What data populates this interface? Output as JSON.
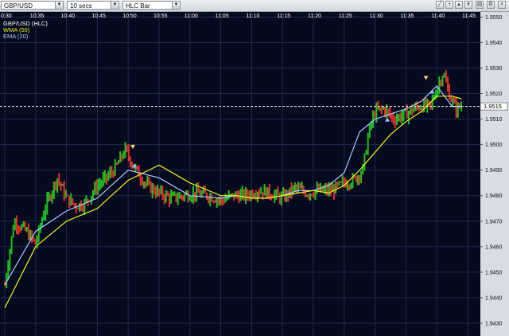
{
  "toolbar": {
    "symbol": "GBP/USD",
    "interval": "10 secs",
    "chart_style": "HLC Bar",
    "tools": [
      "draw-line-icon",
      "crosshair-icon",
      "zoom-in-icon",
      "zoom-out-icon",
      "print-icon",
      "settings-icon",
      "close-icon"
    ]
  },
  "legend": {
    "price": "GBP/USD (HLC)",
    "wma": "WMA (55)",
    "ema": "EMA (20)"
  },
  "colors": {
    "background": "#050a1e",
    "grid": "#1c2a4e",
    "up_bar": "#20c020",
    "down_bar": "#e03030",
    "wma": "#f0f020",
    "ema": "#b0c8ff",
    "marker_sell": "#ffd080",
    "marker_buy": "#9ec6ff"
  },
  "chart_data": {
    "type": "line",
    "x_ticks": [
      "0:30",
      "10:35",
      "10:40",
      "10:45",
      "10:50",
      "10:55",
      "11:00",
      "11:05",
      "11:10",
      "11:15",
      "11:20",
      "11:25",
      "11:30",
      "11:35",
      "11:40",
      "11:45"
    ],
    "y_ticks": [
      1.943,
      1.944,
      1.945,
      1.946,
      1.947,
      1.948,
      1.949,
      1.95,
      1.951,
      1.952,
      1.953,
      1.954,
      1.955
    ],
    "ylim": [
      1.9425,
      1.9552
    ],
    "current_price": 1.9515,
    "current_price_label": "1.9515",
    "grid": true,
    "series": [
      {
        "name": "WMA (55)",
        "color": "#f0f020",
        "x": [
          0.0,
          1.0,
          2.0,
          3.0,
          4.0,
          5.0,
          6.0,
          7.0,
          7.5,
          8.0,
          8.5,
          9.0,
          9.5,
          10.0,
          10.5,
          11.0,
          11.5,
          12.0,
          12.5,
          13.0,
          13.5,
          14.0,
          14.5,
          14.8
        ],
        "values": [
          1.9436,
          1.946,
          1.947,
          1.9475,
          1.9486,
          1.9492,
          1.9485,
          1.948,
          1.948,
          1.9479,
          1.9479,
          1.948,
          1.9481,
          1.9482,
          1.9481,
          1.9484,
          1.949,
          1.9497,
          1.9504,
          1.9509,
          1.9513,
          1.9519,
          1.9519,
          1.9518
        ]
      },
      {
        "name": "EMA (20)",
        "color": "#b0c8ff",
        "x": [
          0.0,
          1.0,
          2.0,
          3.0,
          4.0,
          5.0,
          6.0,
          7.0,
          7.5,
          8.0,
          8.5,
          9.0,
          9.5,
          10.0,
          10.5,
          11.0,
          11.5,
          12.0,
          12.5,
          13.0,
          13.5,
          14.0,
          14.5,
          14.8
        ],
        "values": [
          1.9445,
          1.9466,
          1.9474,
          1.9479,
          1.949,
          1.9487,
          1.948,
          1.9479,
          1.948,
          1.9479,
          1.9479,
          1.948,
          1.9482,
          1.9482,
          1.9484,
          1.9489,
          1.9505,
          1.951,
          1.9512,
          1.9514,
          1.9517,
          1.9523,
          1.9515,
          1.9515
        ]
      }
    ],
    "price_path": {
      "x": [
        0.0,
        0.3,
        0.7,
        1.0,
        1.3,
        1.7,
        2.0,
        2.3,
        2.6,
        3.0,
        3.3,
        3.6,
        3.9,
        4.2,
        4.6,
        5.0,
        5.4,
        5.8,
        6.2,
        6.6,
        7.0,
        7.4,
        7.8,
        8.2,
        8.6,
        9.0,
        9.4,
        9.8,
        10.2,
        10.6,
        11.0,
        11.3,
        11.6,
        11.8,
        12.0,
        12.3,
        12.6,
        13.0,
        13.4,
        13.8,
        14.0,
        14.2,
        14.4,
        14.6,
        14.8
      ],
      "values": [
        1.9445,
        1.947,
        1.9466,
        1.9461,
        1.9475,
        1.9487,
        1.9479,
        1.9476,
        1.9477,
        1.9484,
        1.9487,
        1.9491,
        1.9498,
        1.9491,
        1.9484,
        1.9481,
        1.9479,
        1.948,
        1.9481,
        1.948,
        1.9478,
        1.948,
        1.948,
        1.9482,
        1.9481,
        1.9479,
        1.9483,
        1.9481,
        1.9482,
        1.9482,
        1.9485,
        1.9486,
        1.949,
        1.9505,
        1.9513,
        1.9514,
        1.951,
        1.9512,
        1.9515,
        1.9515,
        1.9522,
        1.9528,
        1.952,
        1.9514,
        1.9515
      ]
    },
    "markers": [
      {
        "kind": "sell",
        "x": 4.15,
        "value": 1.9499
      },
      {
        "kind": "buy",
        "x": 4.2,
        "value": 1.9492
      },
      {
        "kind": "buy",
        "x": 12.4,
        "value": 1.951
      },
      {
        "kind": "sell",
        "x": 13.65,
        "value": 1.9526
      },
      {
        "kind": "buy",
        "x": 13.85,
        "value": 1.9521
      }
    ]
  }
}
